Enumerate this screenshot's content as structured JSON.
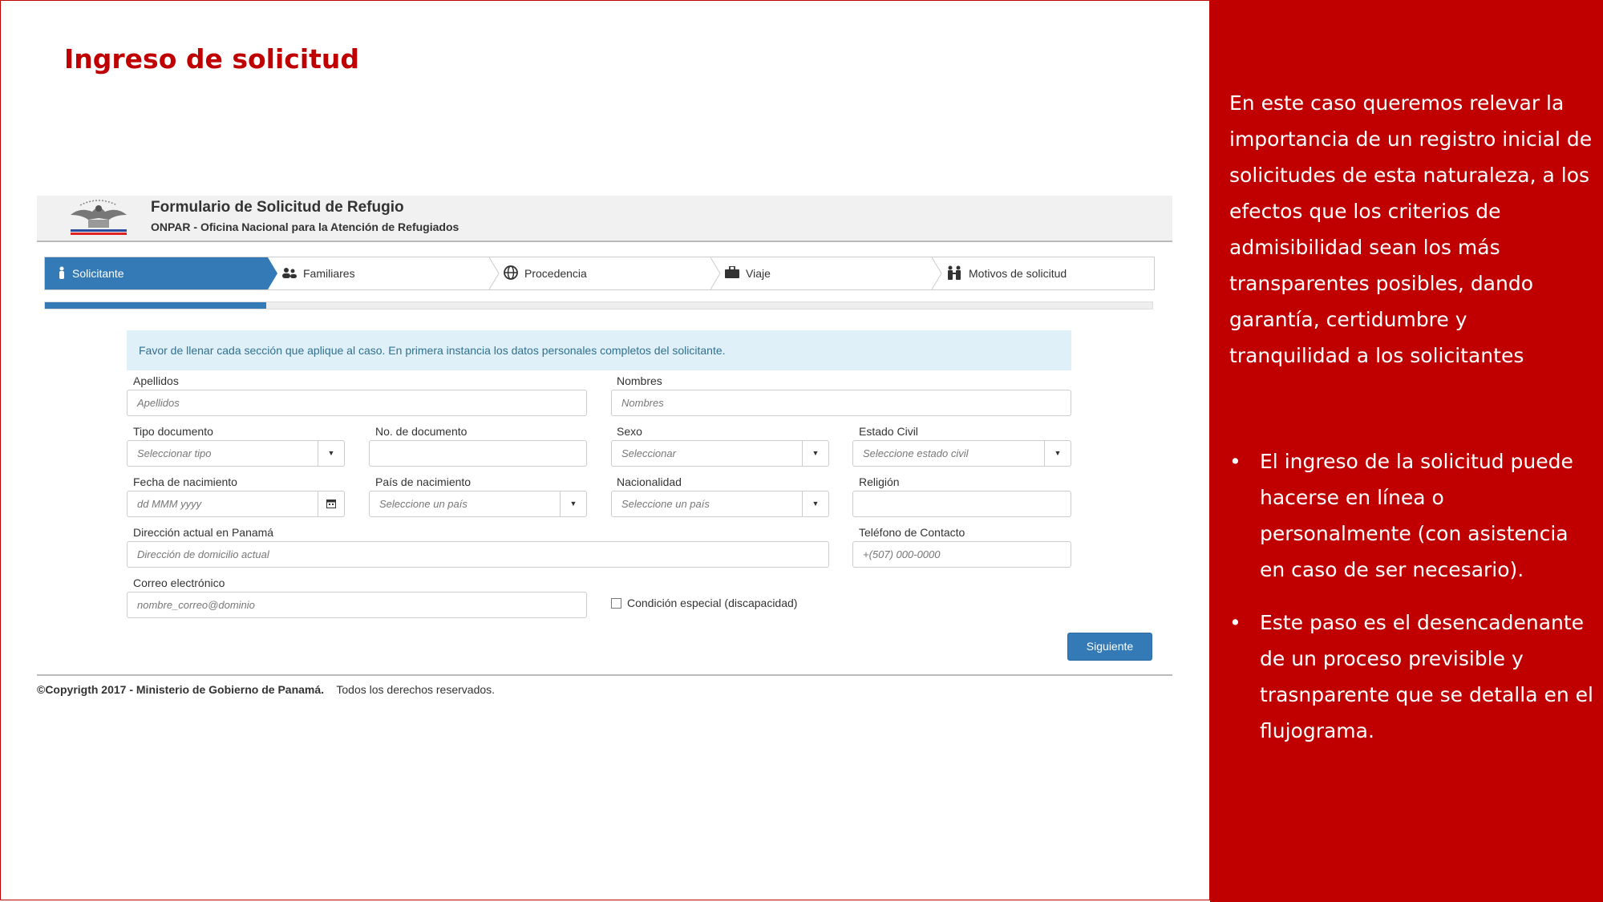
{
  "slide": {
    "title": "Ingreso de solicitud",
    "intro": "En este caso queremos relevar la importancia de un registro inicial de solicitudes de esta naturaleza, a los efectos que los criterios de admisibilidad sean los más transparentes posibles, dando garantía, certidumbre y tranquilidad a los solicitantes",
    "bullets": [
      "El ingreso de la solicitud puede hacerse en línea o personalmente (con asistencia en caso de ser necesario).",
      "Este paso es el desencadenante de un proceso previsible y trasnparente que se detalla en el flujograma."
    ],
    "bullet_char": "•",
    "accent_color": "#c00000"
  },
  "form": {
    "title": "Formulario de Solicitud de Refugio",
    "subtitle": "ONPAR - Oficina Nacional para la Atención de Refugiados",
    "logo_icon": "ministerio-de-gobierno-logo",
    "steps": [
      {
        "label": "Solicitante",
        "icon": "person-icon",
        "active": true
      },
      {
        "label": "Familiares",
        "icon": "family-icon",
        "active": false
      },
      {
        "label": "Procedencia",
        "icon": "globe-icon",
        "active": false
      },
      {
        "label": "Viaje",
        "icon": "briefcase-icon",
        "active": false
      },
      {
        "label": "Motivos de solicitud",
        "icon": "people-icon",
        "active": false
      }
    ],
    "progress_fraction": 0.2,
    "alert": "Favor de llenar cada sección que aplique al caso. En primera instancia los datos personales completos del solicitante.",
    "fields": {
      "apellidos": {
        "label": "Apellidos",
        "placeholder": "Apellidos"
      },
      "nombres": {
        "label": "Nombres",
        "placeholder": "Nombres"
      },
      "tipo_documento": {
        "label": "Tipo documento",
        "placeholder": "Seleccionar tipo"
      },
      "no_documento": {
        "label": "No. de documento",
        "placeholder": ""
      },
      "sexo": {
        "label": "Sexo",
        "placeholder": "Seleccionar"
      },
      "estado_civil": {
        "label": "Estado Civil",
        "placeholder": "Seleccione estado civil"
      },
      "fecha_nacimiento": {
        "label": "Fecha de nacimiento",
        "placeholder": "dd MMM yyyy"
      },
      "pais_nacimiento": {
        "label": "País de nacimiento",
        "placeholder": "Seleccione un país"
      },
      "nacionalidad": {
        "label": "Nacionalidad",
        "placeholder": "Seleccione un país"
      },
      "religion": {
        "label": "Religión",
        "placeholder": ""
      },
      "direccion": {
        "label": "Dirección actual en Panamá",
        "placeholder": "Dirección de domicilio actual"
      },
      "telefono": {
        "label": "Teléfono de Contacto",
        "placeholder": "+(507) 000-0000"
      },
      "correo": {
        "label": "Correo electrónico",
        "placeholder": "nombre_correo@dominio"
      }
    },
    "checkbox_label": "Condición especial (discapacidad)",
    "next_button": "Siguiente",
    "footer_bold": "©Copyrigth 2017 - Ministerio de Gobierno de Panamá.",
    "footer_rest": "Todos los derechos reservados."
  }
}
